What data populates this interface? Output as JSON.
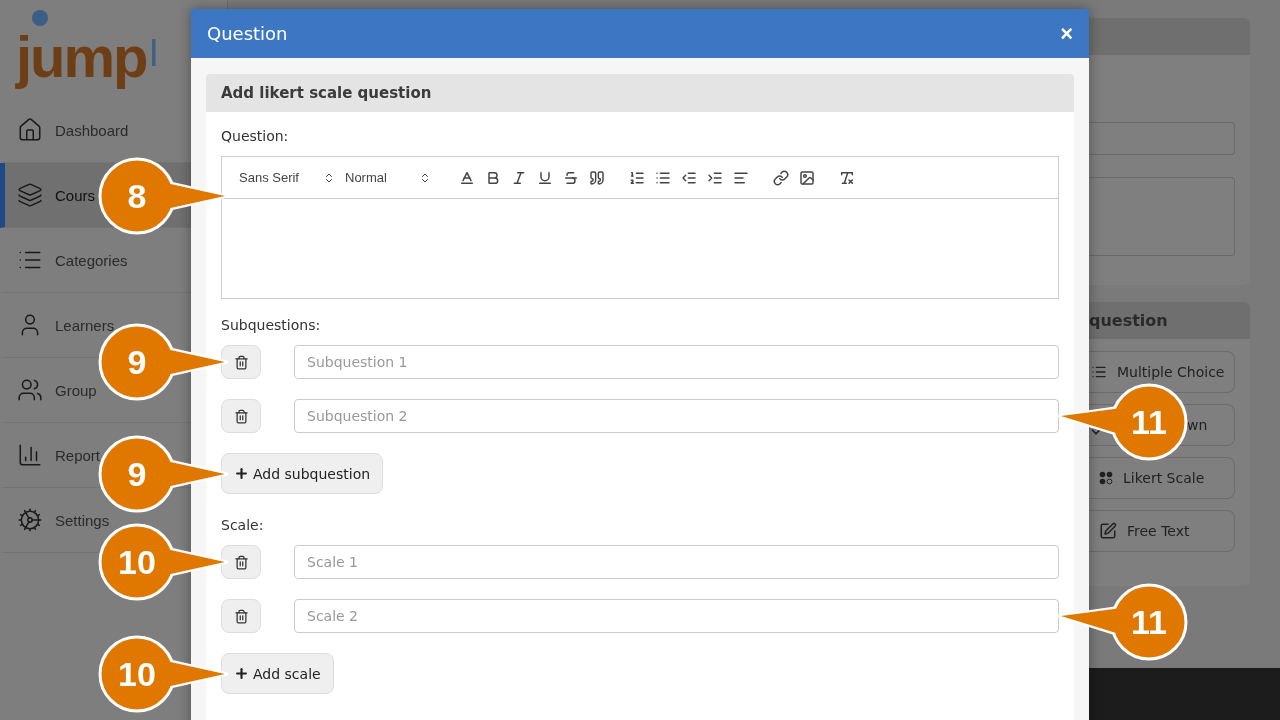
{
  "sidebar": {
    "logo": {
      "text": "jump",
      "suffix": "I"
    },
    "items": [
      {
        "label": "Dashboard",
        "kind": "home",
        "selected": false
      },
      {
        "label": "Cours",
        "kind": "layers",
        "selected": true
      },
      {
        "label": "Categories",
        "kind": "list",
        "selected": false
      },
      {
        "label": "Learners",
        "kind": "user",
        "selected": false
      },
      {
        "label": "Group",
        "kind": "users",
        "selected": false
      },
      {
        "label": "Report",
        "kind": "chart",
        "selected": false
      },
      {
        "label": "Settings",
        "kind": "gear",
        "selected": false
      }
    ]
  },
  "right_panel": {
    "section_title": "question",
    "buttons": [
      {
        "label": "Multiple Choice",
        "kind": "list"
      },
      {
        "label": "wn",
        "kind": "dropdown"
      },
      {
        "label": "Likert Scale",
        "kind": "likert"
      },
      {
        "label": "Free Text",
        "kind": "text"
      }
    ]
  },
  "modal": {
    "title": "Question",
    "close": "×",
    "card": {
      "title": "Add likert scale question",
      "question_label": "Question:",
      "editor": {
        "font": "Sans Serif",
        "size": "Normal",
        "callout": "8"
      },
      "subquestions": {
        "label": "Subquestions:",
        "add_button": "Add subquestion",
        "add_callout": "9",
        "items": [
          {
            "placeholder": "Subquestion 1",
            "delete_callout": "9"
          },
          {
            "placeholder": "Subquestion 2",
            "input_callout": "11"
          }
        ]
      },
      "scale": {
        "label": "Scale:",
        "add_button": "Add scale",
        "add_callout": "10",
        "items": [
          {
            "placeholder": "Scale 1",
            "delete_callout": "10"
          },
          {
            "placeholder": "Scale 2",
            "input_callout": "11"
          }
        ]
      }
    }
  }
}
